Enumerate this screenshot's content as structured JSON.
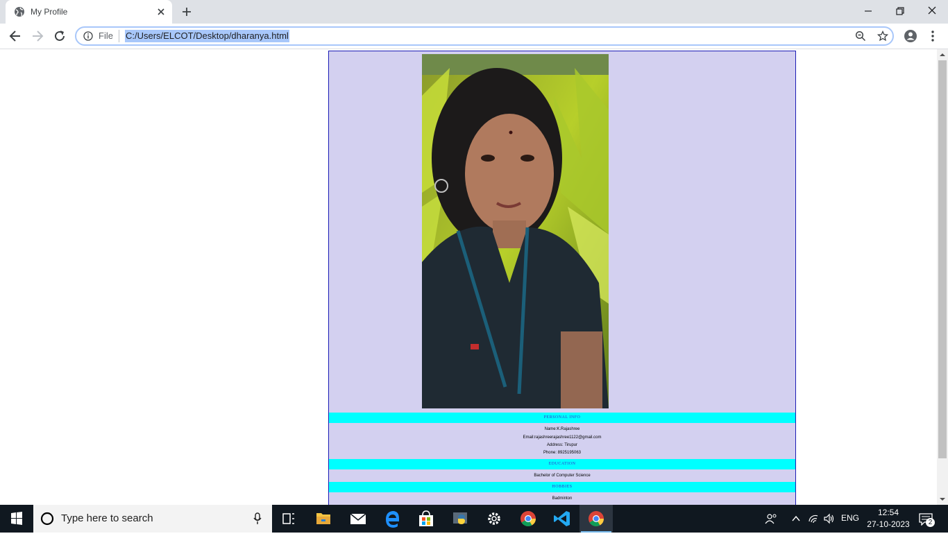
{
  "browser": {
    "tab_title": "My Profile",
    "scheme_label": "File",
    "url": "C:/Users/ELCOT/Desktop/dharanya.html",
    "icons": [
      "globe-icon",
      "close-icon",
      "plus-icon",
      "back-arrow-icon",
      "forward-arrow-icon",
      "reload-icon",
      "info-icon",
      "zoom-icon",
      "star-icon",
      "profile-icon",
      "menu-icon"
    ]
  },
  "page": {
    "photo_alt": "profile photo",
    "personal_heading": "PERSONAL INFO",
    "name_line": "Name:K.Rajashree",
    "email_line": "Email:rajashreerajashree1122@gmail.com",
    "address_line": "Address: Tirupur",
    "phone_line": "Phone: 8925195063",
    "education_heading": "EDUCATION",
    "education_line": "Bachelor of Computer Science",
    "hobbies_heading": "HOBBIES",
    "hobbies_line": "Badminton",
    "colors": {
      "panel_bg": "#d3d0f0",
      "section_bg": "#00ffff",
      "heading_text": "#3333cc",
      "border": "#1b1bb5"
    }
  },
  "taskbar": {
    "search_placeholder": "Type here to search",
    "language": "ENG",
    "time": "12:54",
    "date": "27-10-2023",
    "notification_count": "2"
  }
}
